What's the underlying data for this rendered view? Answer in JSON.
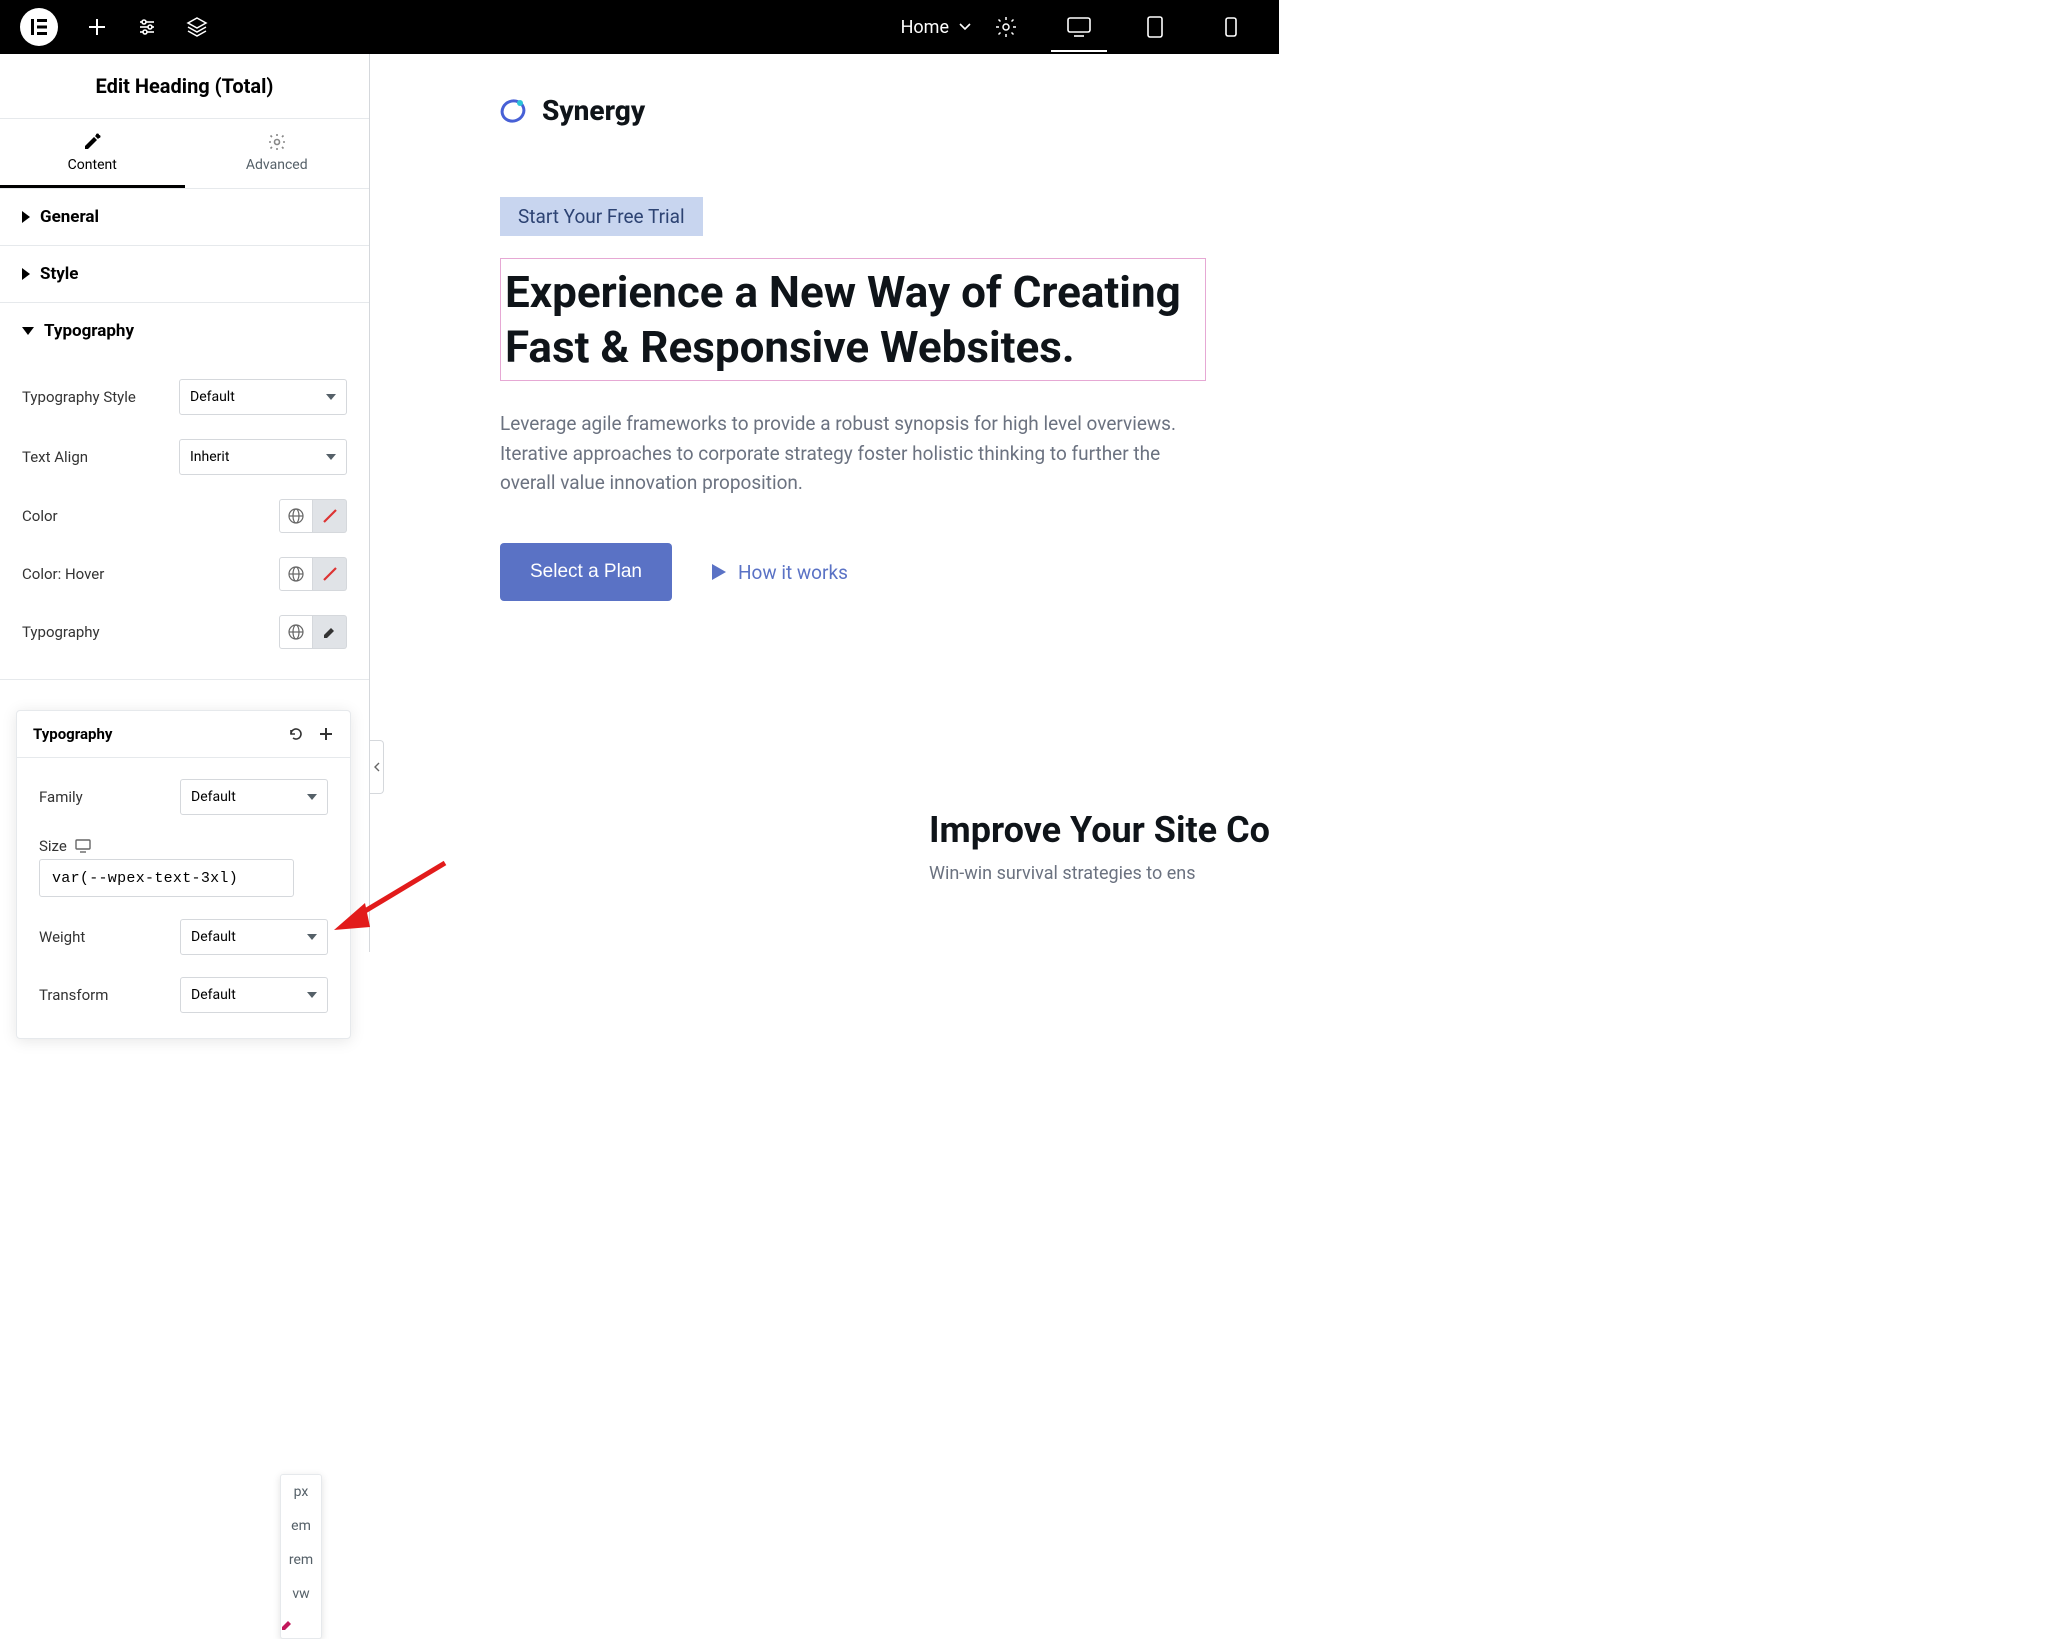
{
  "topbar": {
    "page_label": "Home"
  },
  "panel": {
    "title": "Edit Heading (Total)",
    "tabs": {
      "content": "Content",
      "advanced": "Advanced"
    },
    "sections": {
      "general": "General",
      "style": "Style",
      "typography": "Typography"
    },
    "controls": {
      "typography_style": {
        "label": "Typography Style",
        "value": "Default"
      },
      "text_align": {
        "label": "Text Align",
        "value": "Inherit"
      },
      "color": {
        "label": "Color"
      },
      "color_hover": {
        "label": "Color: Hover"
      },
      "typography": {
        "label": "Typography"
      }
    }
  },
  "popup": {
    "title": "Typography",
    "family": {
      "label": "Family",
      "value": "Default"
    },
    "size": {
      "label": "Size",
      "value": "var(--wpex-text-3xl)"
    },
    "weight": {
      "label": "Weight",
      "value": "Default"
    },
    "transform": {
      "label": "Transform",
      "value": "Default"
    },
    "units": [
      "px",
      "em",
      "rem",
      "vw"
    ]
  },
  "canvas": {
    "brand": "Synergy",
    "trial": "Start Your Free Trial",
    "heading": "Experience a New Way of Creating Fast & Responsive Websites.",
    "subtext": "Leverage agile frameworks to provide a robust synopsis for high level overviews. Iterative approaches to corporate strategy foster holistic thinking to further the overall value innovation proposition.",
    "cta_primary": "Select a Plan",
    "cta_secondary": "How it works",
    "second_heading": "Improve Your Site Co",
    "second_sub": "Win-win survival strategies to ens"
  }
}
